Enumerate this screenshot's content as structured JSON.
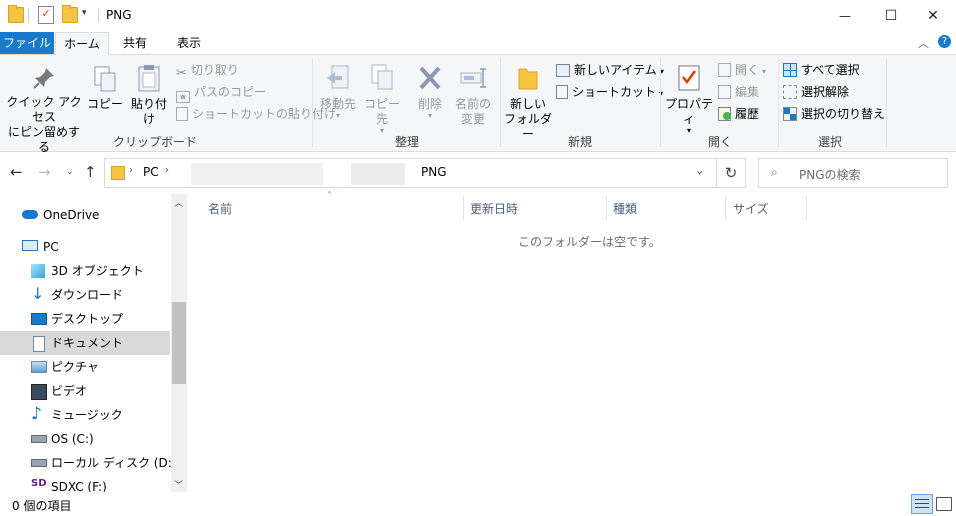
{
  "window": {
    "title": "PNG",
    "controls": {
      "minimize": "—",
      "maximize": "☐",
      "close": "✕"
    }
  },
  "ribbon_tabs": [
    {
      "label": "ファイル"
    },
    {
      "label": "ホーム"
    },
    {
      "label": "共有"
    },
    {
      "label": "表示"
    }
  ],
  "ribbon": {
    "clipboard": {
      "label": "クリップボード",
      "pin_line1": "クイック アクセス",
      "pin_line2": "にピン留めする",
      "copy": "コピー",
      "paste": "貼り付け",
      "cut": "切り取り",
      "copy_path": "パスのコピー",
      "paste_shortcut": "ショートカットの貼り付け"
    },
    "organize": {
      "label": "整理",
      "move_to": "移動先",
      "copy_to": "コピー先",
      "delete": "削除",
      "rename_line1": "名前の",
      "rename_line2": "変更"
    },
    "new": {
      "label": "新規",
      "new_folder_line1": "新しい",
      "new_folder_line2": "フォルダー",
      "new_item": "新しいアイテム",
      "easy_access": "ショートカット"
    },
    "open": {
      "label": "開く",
      "properties": "プロパティ",
      "open": "開く",
      "edit": "編集",
      "history": "履歴"
    },
    "select": {
      "label": "選択",
      "select_all": "すべて選択",
      "select_none": "選択解除",
      "invert": "選択の切り替え"
    }
  },
  "address": {
    "segments": [
      "PC",
      "PNG"
    ],
    "search_placeholder": "PNGの検索"
  },
  "nav": [
    {
      "label": "OneDrive",
      "icon": "onedrive-icon"
    },
    {
      "label": "PC",
      "icon": "pc-icon"
    },
    {
      "label": "3D オブジェクト",
      "icon": "3d-objects-icon"
    },
    {
      "label": "ダウンロード",
      "icon": "downloads-icon"
    },
    {
      "label": "デスクトップ",
      "icon": "desktop-icon"
    },
    {
      "label": "ドキュメント",
      "icon": "documents-icon",
      "selected": true
    },
    {
      "label": "ピクチャ",
      "icon": "pictures-icon"
    },
    {
      "label": "ビデオ",
      "icon": "videos-icon"
    },
    {
      "label": "ミュージック",
      "icon": "music-icon"
    },
    {
      "label": "OS (C:)",
      "icon": "drive-c-icon"
    },
    {
      "label": "ローカル ディスク (D:)",
      "icon": "drive-d-icon"
    },
    {
      "label": "SDXC (F:)",
      "icon": "sd-card-icon"
    }
  ],
  "columns": [
    {
      "label": "名前"
    },
    {
      "label": "更新日時"
    },
    {
      "label": "種類"
    },
    {
      "label": "サイズ"
    }
  ],
  "empty_message": "このフォルダーは空です。",
  "status": {
    "item_count": "0 個の項目"
  },
  "colors": {
    "accent": "#1979ca",
    "ribbon_bg": "#f5f6f7",
    "selected_bg": "#d9d9d9"
  }
}
